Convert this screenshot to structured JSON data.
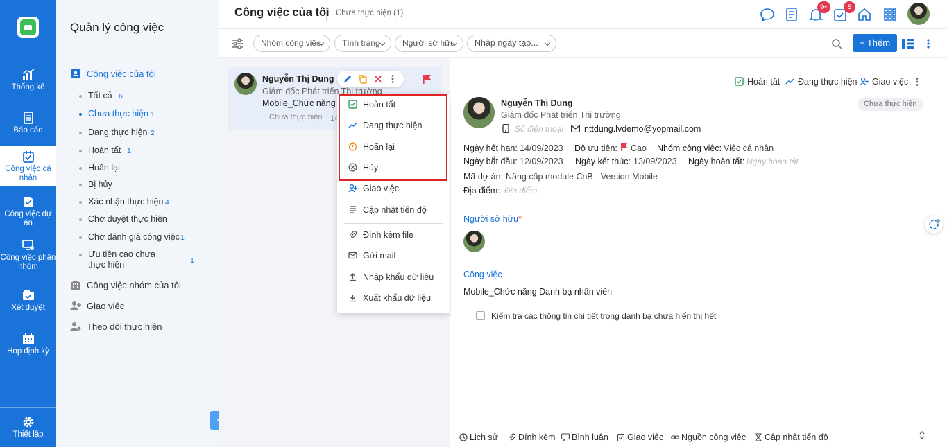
{
  "rail": {
    "items": [
      {
        "label": "Thống kê",
        "icon": "bar-chart-icon"
      },
      {
        "label": "Báo cáo",
        "icon": "report-icon"
      },
      {
        "label": "Công việc cá nhân",
        "icon": "personal-task-icon"
      },
      {
        "label": "Công việc dự án",
        "icon": "project-task-icon"
      },
      {
        "label": "Công việc phân nhóm",
        "icon": "group-task-icon"
      },
      {
        "label": "Xét duyệt",
        "icon": "approval-icon"
      },
      {
        "label": "Họp định kỳ",
        "icon": "calendar-icon"
      }
    ],
    "settings": "Thiết lập"
  },
  "side": {
    "title": "Quản lý công việc",
    "my_tasks": "Công việc của tôi",
    "sub": [
      {
        "label": "Tất cả",
        "count": "6"
      },
      {
        "label": "Chưa thực hiện",
        "count": "1"
      },
      {
        "label": "Đang thực hiện",
        "count": "2"
      },
      {
        "label": "Hoàn tất",
        "count": "1"
      },
      {
        "label": "Hoãn lại",
        "count": ""
      },
      {
        "label": "Bị hủy",
        "count": ""
      },
      {
        "label": "Xác nhận thực hiện",
        "count": "4"
      },
      {
        "label": "Chờ duyệt thực hiện",
        "count": ""
      },
      {
        "label": "Chờ đánh giá công việc",
        "count": "1"
      },
      {
        "label": "Ưu tiên cao chưa thực hiện",
        "count": "1"
      }
    ],
    "group_tasks": "Công việc nhóm của tôi",
    "assign": "Giao việc",
    "follow": "Theo dõi thực hiện"
  },
  "header": {
    "title": "Công việc của tôi",
    "subtitle": "Chưa thực hiện (1)",
    "notif_badge": "9+",
    "task_badge": "5"
  },
  "filters": {
    "group": "Nhóm công việc",
    "status": "Tình trạng",
    "owner": "Người sở hữu",
    "date": "Nhập ngày tạo...",
    "add": "+ Thêm"
  },
  "card": {
    "name": "Nguyễn Thị Dung",
    "role": "Giám đốc Phát triển Thị trường",
    "project": "Mobile_Chức năng D",
    "status": "Chưa thực hiện",
    "date": "14"
  },
  "menu": {
    "items": [
      "Hoàn tất",
      "Đang thực hiện",
      "Hoãn lại",
      "Hủy",
      "Giao việc",
      "Cập nhật tiến độ",
      "Đính kèm file",
      "Gửi mail",
      "Nhập khẩu dữ liệu",
      "Xuất khẩu dữ liệu"
    ]
  },
  "detail": {
    "actions": {
      "done": "Hoàn tất",
      "doing": "Đang thực hiện",
      "assign": "Giao việc"
    },
    "name": "Nguyễn Thị Dung",
    "role": "Giám đốc Phát triển Thị trường",
    "status": "Chưa thực hiện",
    "phone_ph": "Số điện thoại",
    "email": "nttdung.lvdemo@yopmail.com",
    "due_label": "Ngày hết hạn:",
    "due": "14/09/2023",
    "priority_label": "Độ ưu tiên:",
    "priority": "Cao",
    "group_label": "Nhóm công việc:",
    "group": "Việc cá nhân",
    "start_label": "Ngày bắt đầu:",
    "start": "12/09/2023",
    "end_label": "Ngày kết thúc:",
    "end": "13/09/2023",
    "complete_label": "Ngày hoàn tất:",
    "complete_ph": "Ngày hoàn tất",
    "project_label": "Mã dự án:",
    "project": "Nâng cấp module CnB - Version Mobile",
    "place_label": "Địa điểm:",
    "place_ph": "Địa điểm",
    "owner_section": "Người sở hữu",
    "task_section": "Công việc",
    "task_name": "Mobile_Chức năng Danh bạ nhân viên",
    "checklist": "Kiểm tra các thông tin chi tiết trong danh bạ chưa hiển thị hết"
  },
  "footer": [
    "Lịch sử",
    "Đính kèm",
    "Bình luận",
    "Giao việc",
    "Nguồn công việc",
    "Cập nhật tiến độ"
  ],
  "colors": {
    "primary": "#1a73d9",
    "danger": "#e5384e",
    "highlight_box": "#e02424"
  }
}
